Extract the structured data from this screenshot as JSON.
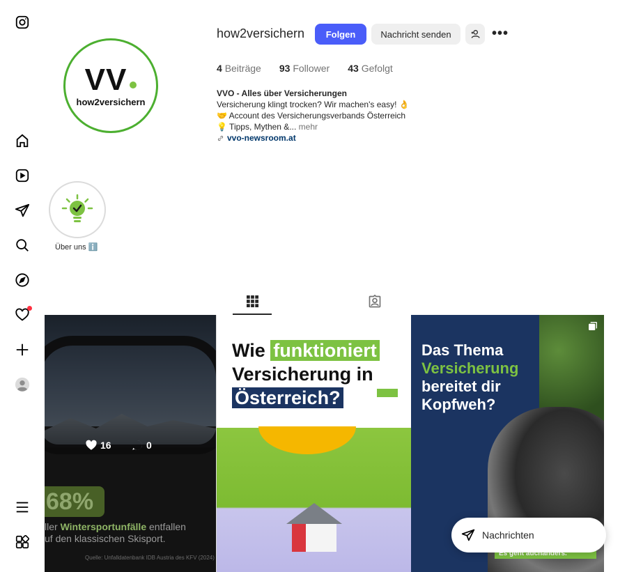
{
  "nav": {
    "items": [
      "instagram-logo",
      "home",
      "reels",
      "messages",
      "search",
      "explore",
      "notifications",
      "create",
      "profile",
      "more",
      "also-from-meta"
    ]
  },
  "profile": {
    "username": "how2versichern",
    "follow_label": "Folgen",
    "message_label": "Nachricht senden",
    "stats": {
      "posts_count": "4",
      "posts_label": "Beiträge",
      "followers_count": "93",
      "followers_label": "Follower",
      "following_count": "43",
      "following_label": "Gefolgt"
    },
    "bio": {
      "name": "VVO - Alles über Versicherungen",
      "line1": "Versicherung klingt trocken? Wir machen's easy! 👌",
      "line2": "🤝 Account des Versicherungsverbands Österreich",
      "line3": "💡 Tipps, Mythen &...",
      "more_label": "mehr",
      "link": "vvo-newsroom.at"
    },
    "avatar": {
      "logo_main": "VV",
      "logo_sub": "how2versichern"
    }
  },
  "highlights": [
    {
      "label": "Über uns ℹ️"
    }
  ],
  "posts": [
    {
      "likes": "16",
      "comments": "0",
      "percent": "68%",
      "caption_pre": "ller ",
      "caption_highlight": "Wintersportunfälle",
      "caption_post": " entfallen",
      "caption_line2": "uf den klassischen Skisport.",
      "source": "Quelle: Unfalldatenbank IDB Austria des KFV (2024)"
    },
    {
      "line1": "Wie",
      "line1_highlight": "funktioniert",
      "line2": "Versicherung in",
      "line3": "Österreich?"
    },
    {
      "line1": "Das Thema",
      "line2": "Versicherung",
      "line3": "bereitet dir",
      "line4": "Kopfweh?",
      "tag_pre": "Es geht auch ",
      "tag_bold": "anders."
    }
  ],
  "messages_bar": {
    "label": "Nachrichten"
  },
  "colors": {
    "accent": "#4a5df9",
    "brand_green": "#7dc242",
    "brand_navy": "#1b3461",
    "notification_dot": "#ff3040"
  }
}
